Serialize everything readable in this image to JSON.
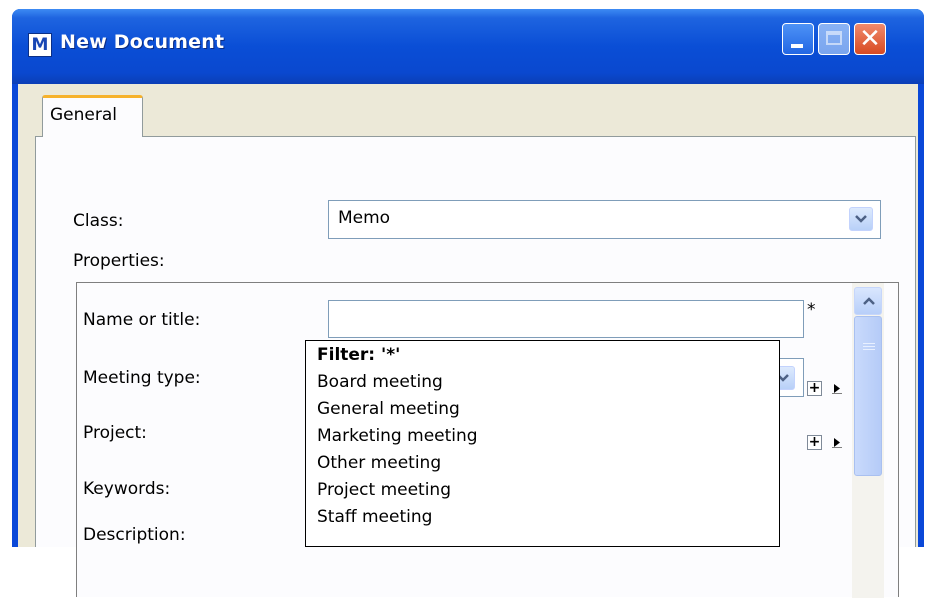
{
  "window": {
    "title": "New Document",
    "app_icon_letter": "M"
  },
  "tabs": [
    {
      "label": "General"
    }
  ],
  "class": {
    "label": "Class:",
    "value": "Memo"
  },
  "properties": {
    "label": "Properties:",
    "required_marker": "*",
    "fields": [
      {
        "label": "Name or title:",
        "value": ""
      },
      {
        "label": "Meeting type:",
        "value": ""
      },
      {
        "label": "Project:"
      },
      {
        "label": "Keywords:"
      },
      {
        "label": "Description:"
      }
    ],
    "add_symbol": "+"
  },
  "dropdown": {
    "filter": "Filter: '*'",
    "options": [
      "Board meeting",
      "General meeting",
      "Marketing meeting",
      "Other meeting",
      "Project meeting",
      "Staff meeting"
    ]
  },
  "colors": {
    "titlebar": "#0a4ed6",
    "client_bg": "#ece9d8",
    "tab_highlight": "#f6b22c",
    "close_button": "#d84a22"
  }
}
